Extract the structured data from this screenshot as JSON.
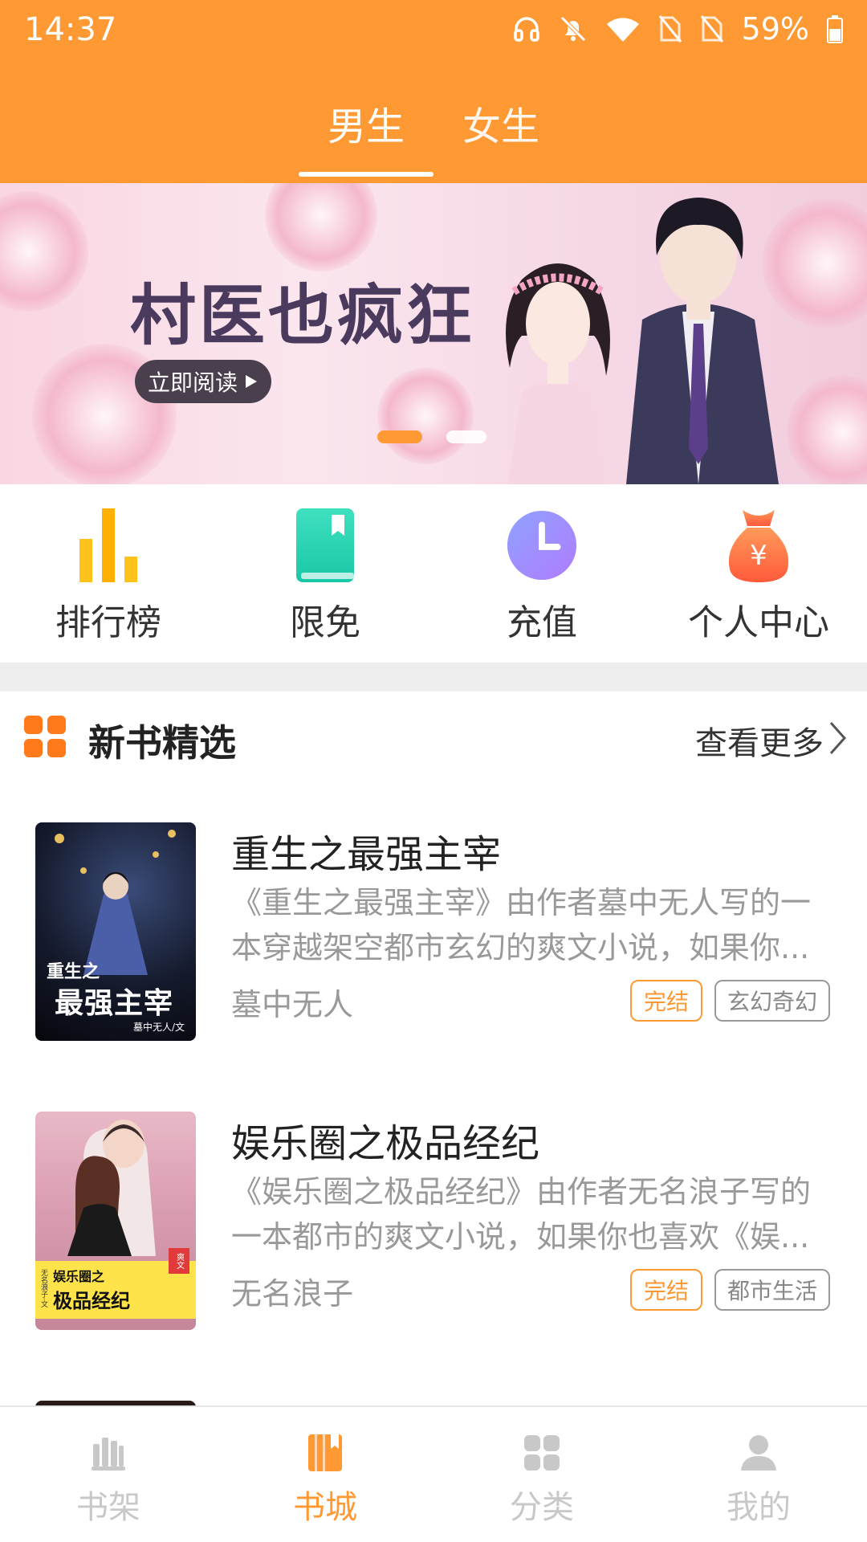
{
  "status_bar": {
    "time": "14:37",
    "battery": "59%"
  },
  "tabs": [
    {
      "label": "男生",
      "active": true
    },
    {
      "label": "女生",
      "active": false
    }
  ],
  "banner": {
    "title": "村医也疯狂",
    "button": "立即阅读",
    "slides": 2,
    "active_slide": 1
  },
  "quick_menu": [
    {
      "label": "排行榜",
      "icon": "bar-chart-icon"
    },
    {
      "label": "限免",
      "icon": "book-icon"
    },
    {
      "label": "充值",
      "icon": "clock-icon"
    },
    {
      "label": "个人中心",
      "icon": "money-bag-icon"
    }
  ],
  "section": {
    "title": "新书精选",
    "more": "查看更多"
  },
  "books": [
    {
      "title": "重生之最强主宰",
      "description": "《重生之最强主宰》由作者墓中无人写的一本穿越架空都市玄幻的爽文小说，如果你...",
      "author": "墓中无人",
      "status": "完结",
      "genre": "玄幻奇幻",
      "cover_title_line1": "重生之",
      "cover_title_line2": "最强主宰",
      "cover_author": "墓中无人/文"
    },
    {
      "title": "娱乐圈之极品经纪",
      "description": "《娱乐圈之极品经纪》由作者无名浪子写的一本都市的爽文小说，如果你也喜欢《娱...",
      "author": "无名浪子",
      "status": "完结",
      "genre": "都市生活",
      "cover_title_line1": "娱乐圈之",
      "cover_title_line2": "极品经纪",
      "cover_author": "无名浪子·文",
      "cover_badge": "爽文"
    }
  ],
  "bottom_nav": [
    {
      "label": "书架",
      "icon": "bookshelf-icon",
      "active": false
    },
    {
      "label": "书城",
      "icon": "bookstore-icon",
      "active": true
    },
    {
      "label": "分类",
      "icon": "category-icon",
      "active": false
    },
    {
      "label": "我的",
      "icon": "user-icon",
      "active": false
    }
  ],
  "colors": {
    "accent": "#FF9933",
    "inactive": "#C8C8C8",
    "text": "#222222",
    "muted": "#999999"
  }
}
